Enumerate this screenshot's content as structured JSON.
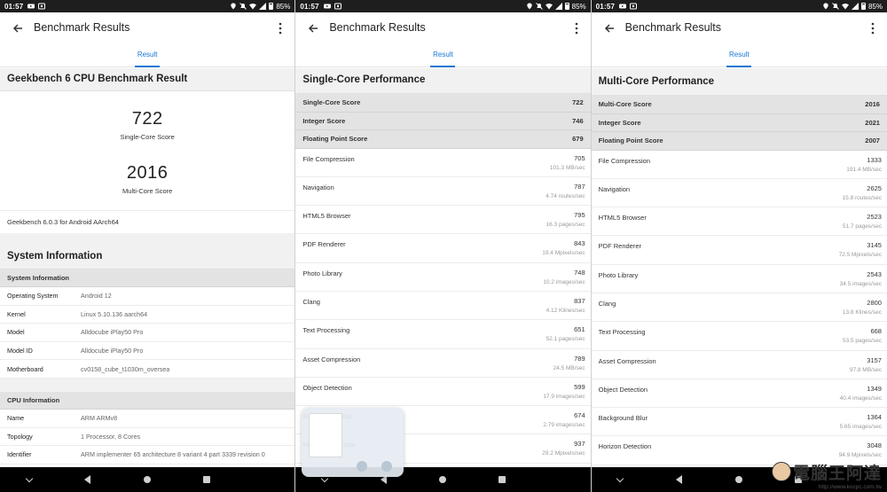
{
  "status": {
    "time": "01:57",
    "battery": "85%"
  },
  "appbar": {
    "title": "Benchmark Results",
    "tab": "Result"
  },
  "phone1": {
    "section_title": "Geekbench 6 CPU Benchmark Result",
    "single_score": "722",
    "single_label": "Single-Core Score",
    "multi_score": "2016",
    "multi_label": "Multi-Core Score",
    "version": "Geekbench 6.0.3 for Android AArch64",
    "sysinfo_title": "System Information",
    "sysinfo_sub": "System Information",
    "sysinfo": [
      {
        "k": "Operating System",
        "v": "Android 12"
      },
      {
        "k": "Kernel",
        "v": "Linux 5.10.136 aarch64"
      },
      {
        "k": "Model",
        "v": "Alldocube iPlay50 Pro"
      },
      {
        "k": "Model ID",
        "v": "Alldocube iPlay50 Pro"
      },
      {
        "k": "Motherboard",
        "v": "cv0158_cube_t1030m_oversea"
      }
    ],
    "cpuinfo_sub": "CPU Information",
    "cpuinfo": [
      {
        "k": "Name",
        "v": "ARM ARMv8"
      },
      {
        "k": "Topology",
        "v": "1 Processor, 8 Cores"
      },
      {
        "k": "Identifier",
        "v": "ARM implementer 65 architecture 8 variant 4 part 3339 revision 0"
      }
    ]
  },
  "phone2": {
    "section_title": "Single-Core Performance",
    "headers": [
      {
        "k": "Single-Core Score",
        "v": "722"
      },
      {
        "k": "Integer Score",
        "v": "746"
      },
      {
        "k": "Floating Point Score",
        "v": "679"
      }
    ],
    "rows": [
      {
        "k": "File Compression",
        "v": "705",
        "s": "101.3 MB/sec"
      },
      {
        "k": "Navigation",
        "v": "787",
        "s": "4.74 routes/sec"
      },
      {
        "k": "HTML5 Browser",
        "v": "795",
        "s": "16.3 pages/sec"
      },
      {
        "k": "PDF Renderer",
        "v": "843",
        "s": "19.4 Mpixels/sec"
      },
      {
        "k": "Photo Library",
        "v": "748",
        "s": "10.2 images/sec"
      },
      {
        "k": "Clang",
        "v": "837",
        "s": "4.12 Klines/sec"
      },
      {
        "k": "Text Processing",
        "v": "651",
        "s": "52.1 pages/sec"
      },
      {
        "k": "Asset Compression",
        "v": "789",
        "s": "24.5 MB/sec"
      },
      {
        "k": "Object Detection",
        "v": "599",
        "s": "17.9 images/sec"
      },
      {
        "k": "Background Blur",
        "v": "674",
        "s": "2.79 images/sec"
      },
      {
        "k": "Horizon Detection",
        "v": "937",
        "s": "29.2 Mpixels/sec"
      }
    ]
  },
  "phone3": {
    "section_title": "Multi-Core Performance",
    "headers": [
      {
        "k": "Multi-Core Score",
        "v": "2016"
      },
      {
        "k": "Integer Score",
        "v": "2021"
      },
      {
        "k": "Floating Point Score",
        "v": "2007"
      }
    ],
    "rows": [
      {
        "k": "File Compression",
        "v": "1333",
        "s": "191.4 MB/sec"
      },
      {
        "k": "Navigation",
        "v": "2625",
        "s": "15.8 routes/sec"
      },
      {
        "k": "HTML5 Browser",
        "v": "2523",
        "s": "51.7 pages/sec"
      },
      {
        "k": "PDF Renderer",
        "v": "3145",
        "s": "72.5 Mpixels/sec"
      },
      {
        "k": "Photo Library",
        "v": "2543",
        "s": "34.5 images/sec"
      },
      {
        "k": "Clang",
        "v": "2800",
        "s": "13.8 Klines/sec"
      },
      {
        "k": "Text Processing",
        "v": "668",
        "s": "53.5 pages/sec"
      },
      {
        "k": "Asset Compression",
        "v": "3157",
        "s": "97.8 MB/sec"
      },
      {
        "k": "Object Detection",
        "v": "1349",
        "s": "40.4 images/sec"
      },
      {
        "k": "Background Blur",
        "v": "1364",
        "s": "5.65 images/sec"
      },
      {
        "k": "Horizon Detection",
        "v": "3048",
        "s": "94.9 Mpixels/sec"
      }
    ]
  },
  "watermark": {
    "text": "電腦王阿達",
    "url": "http://www.kocpc.com.tw"
  },
  "colors": {
    "accent": "#1976d2",
    "header_bg": "#e3e3e3",
    "section_bg": "#f1f1f1"
  }
}
